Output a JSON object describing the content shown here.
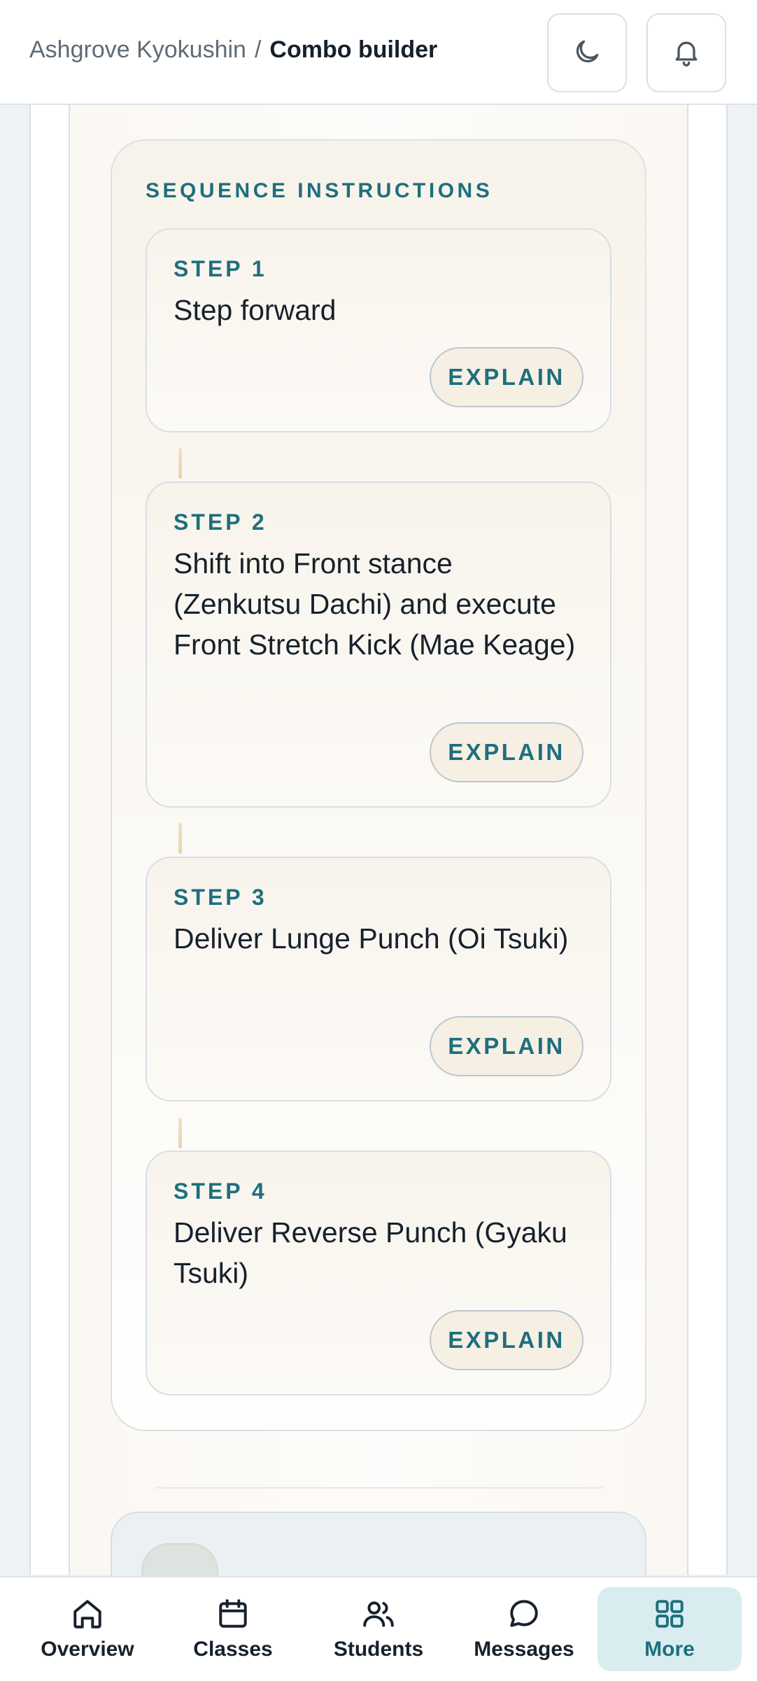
{
  "header": {
    "breadcrumb_parent": "Ashgrove Kyokushin",
    "breadcrumb_separator": "/",
    "breadcrumb_current": "Combo builder",
    "theme_icon": "moon-icon",
    "notifications_icon": "bell-icon"
  },
  "sequence": {
    "title": "SEQUENCE INSTRUCTIONS",
    "steps": [
      {
        "label": "STEP 1",
        "text": "Step forward",
        "action": "EXPLAIN"
      },
      {
        "label": "STEP 2",
        "text": "Shift into Front stance (Zenkutsu Dachi) and execute Front Stretch Kick (Mae Keage)",
        "action": "EXPLAIN"
      },
      {
        "label": "STEP 3",
        "text": "Deliver Lunge Punch (Oi Tsuki)",
        "action": "EXPLAIN"
      },
      {
        "label": "STEP 4",
        "text": "Deliver Reverse Punch (Gyaku Tsuki)",
        "action": "EXPLAIN"
      }
    ]
  },
  "nav": {
    "items": [
      {
        "label": "Overview",
        "icon": "home-icon"
      },
      {
        "label": "Classes",
        "icon": "calendar-icon"
      },
      {
        "label": "Students",
        "icon": "users-icon"
      },
      {
        "label": "Messages",
        "icon": "chat-icon"
      },
      {
        "label": "More",
        "icon": "grid-icon",
        "active": true
      }
    ]
  },
  "colors": {
    "accent": "#1e6f7e",
    "active_nav_bg": "#d9edf0",
    "card_bg": "#f8f4ec"
  }
}
